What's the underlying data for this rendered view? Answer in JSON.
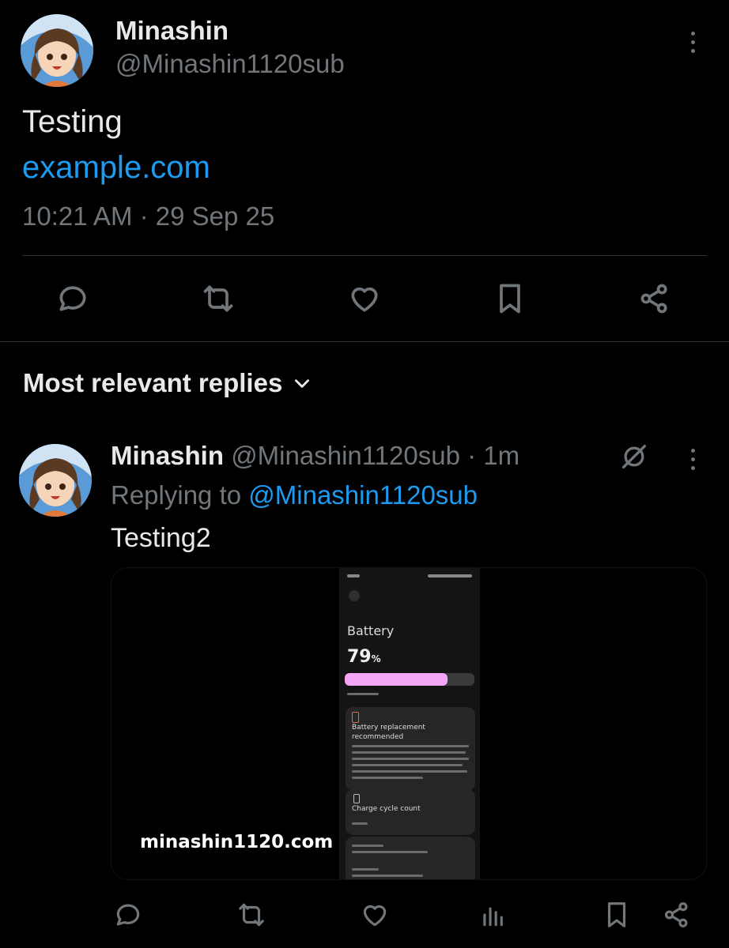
{
  "tweet": {
    "author_name": "Minashin",
    "author_handle": "@Minashin1120sub",
    "text": "Testing",
    "link": "example.com",
    "timestamp": "10:21 AM · 29 Sep 25"
  },
  "actions": {
    "icons": [
      "reply-icon",
      "retweet-icon",
      "like-icon",
      "bookmark-icon",
      "share-icon"
    ]
  },
  "replies": {
    "sort_label": "Most relevant replies"
  },
  "reply": {
    "author_name": "Minashin",
    "author_handle": "@Minashin1120sub",
    "age": "· 1m",
    "replying_prefix": "Replying to",
    "replying_handle": "@Minashin1120sub",
    "text": "Testing2",
    "media": {
      "screen_title": "Battery",
      "battery_level": "79",
      "battery_unit": "%",
      "battery_fraction": 0.79,
      "card1_title": "Battery replacement recommended",
      "card2_title": "Charge cycle count",
      "watermark": "minashin1120.com"
    },
    "action_icons": [
      "reply-icon",
      "retweet-icon",
      "like-icon",
      "views-icon",
      "bookmark-icon",
      "share-icon"
    ]
  },
  "colors": {
    "background": "#000000",
    "text": "#e7e9ea",
    "muted": "#71767b",
    "link": "#1d9bf0",
    "battery_bar": "#f3a6f5"
  }
}
